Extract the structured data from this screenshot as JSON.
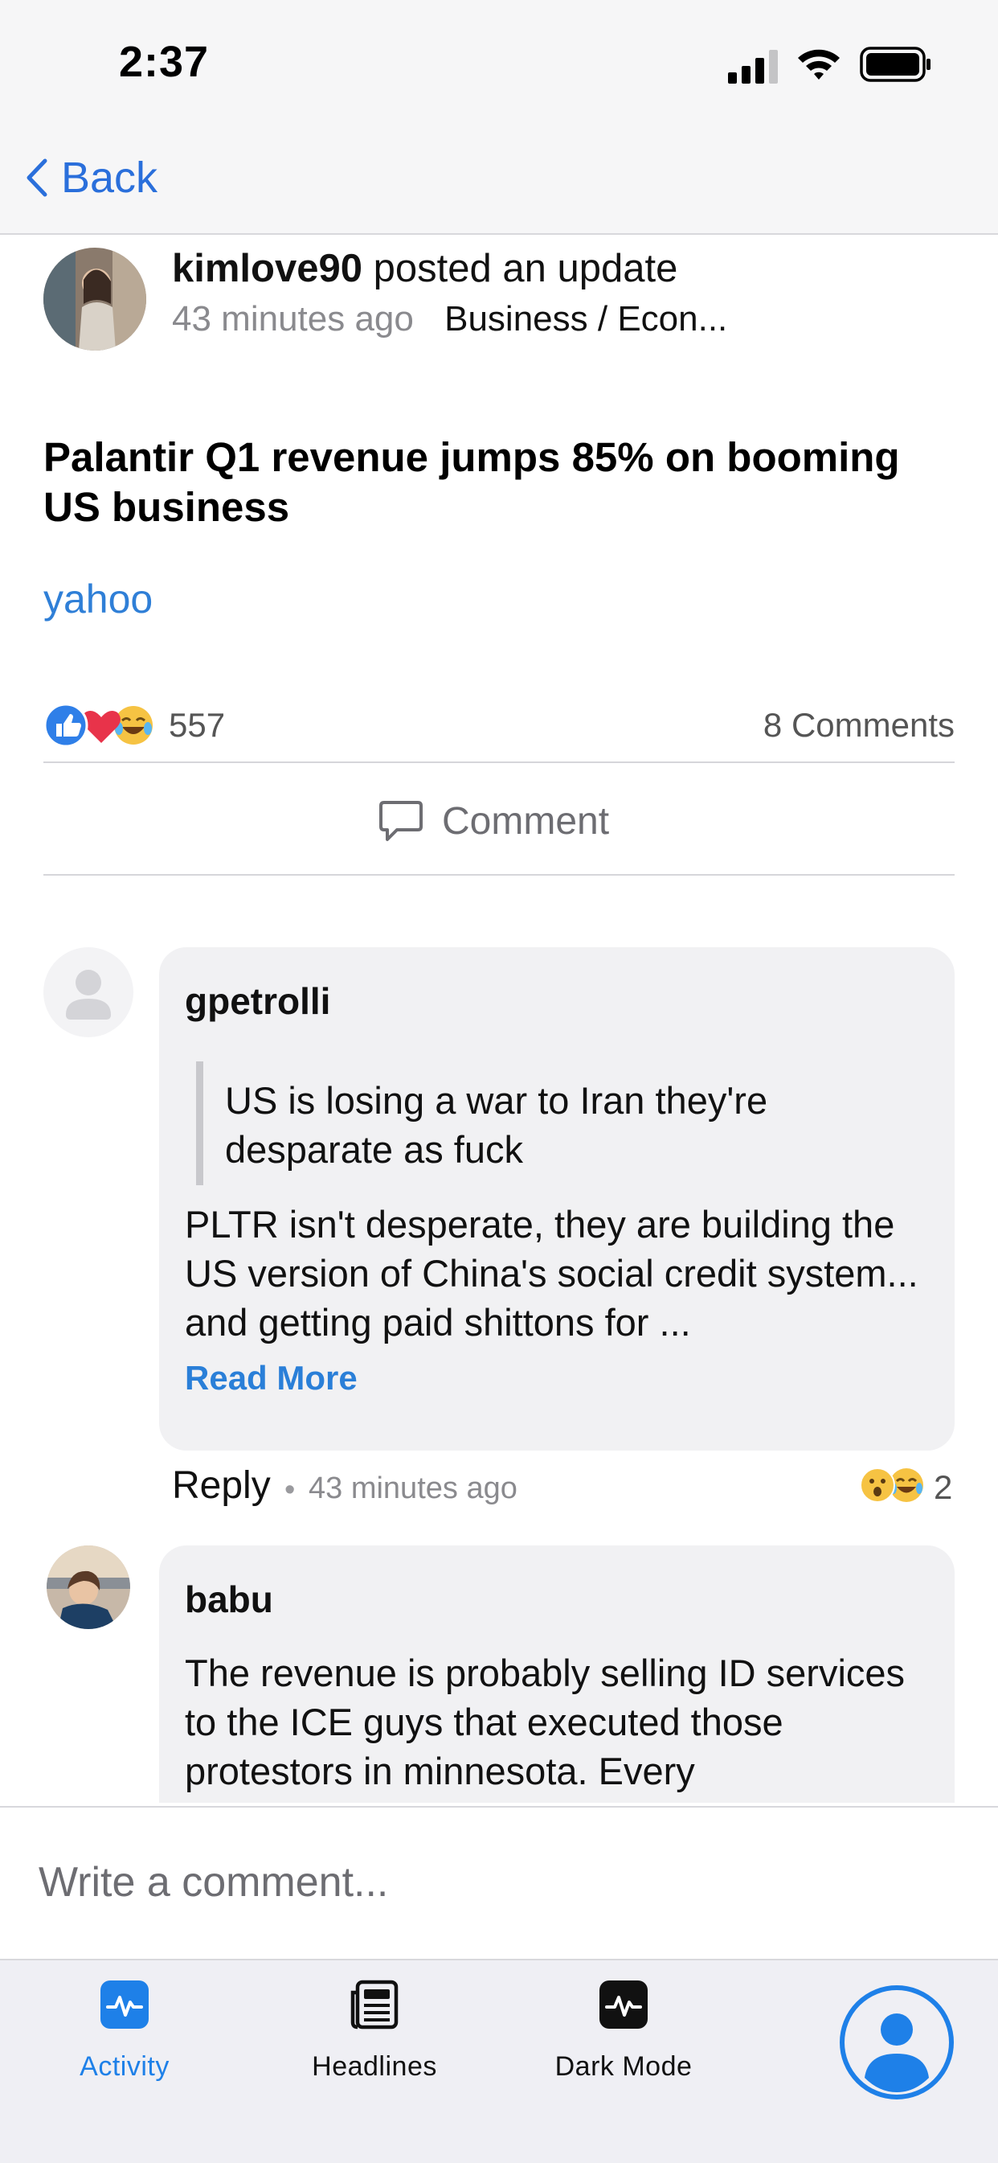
{
  "status_bar": {
    "time": "2:37"
  },
  "nav": {
    "back_label": "Back"
  },
  "post": {
    "author": "kimlove90",
    "action": "posted an update",
    "time_ago": "43 minutes ago",
    "category": "Business / Econ...",
    "title": "Palantir Q1 revenue jumps 85% on booming US business",
    "source": "yahoo",
    "reaction_count": "557",
    "comments_count": "8 Comments",
    "comment_label": "Comment"
  },
  "comments": [
    {
      "author": "gpetrolli",
      "quote": "US is losing a war to Iran they're desparate as fuck",
      "body": "PLTR isn't desperate, they are building the US version of China's social credit system... and getting paid shittons for ...",
      "read_more": "Read More",
      "reply_label": "Reply",
      "dot": "•",
      "time_ago": "43 minutes ago",
      "reaction_count": "2"
    },
    {
      "author": "babu",
      "body": "The revenue is probably selling ID services to the ICE guys that executed those protestors in minnesota. Every"
    }
  ],
  "composer": {
    "placeholder": "Write a comment..."
  },
  "tabs": [
    {
      "label": "Activity",
      "icon": "activity-icon",
      "active": true
    },
    {
      "label": "Headlines",
      "icon": "newspaper-icon"
    },
    {
      "label": "Dark Mode",
      "icon": "dark-mode-icon"
    },
    {
      "label": "",
      "icon": "profile-icon"
    }
  ],
  "colors": {
    "accent": "#2a6fdb",
    "tab_active": "#1e80e8",
    "bubble": "#f1f1f3"
  }
}
